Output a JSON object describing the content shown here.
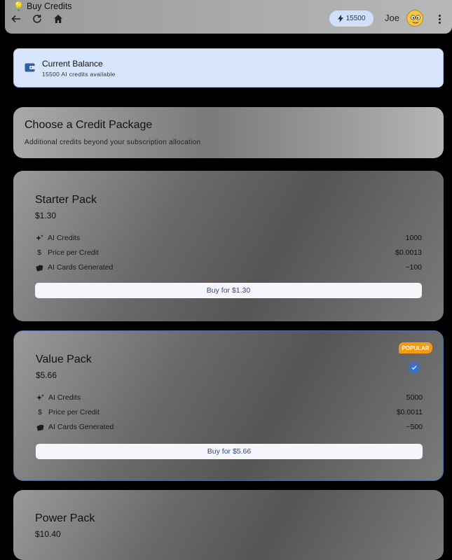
{
  "app": {
    "title": "Buy Credits",
    "credit_chip": "15500",
    "user_name": "Joe"
  },
  "balance": {
    "title": "Current Balance",
    "subtitle": "15500 AI credits available"
  },
  "choose": {
    "title": "Choose a Credit Package",
    "subtitle": "Additional credits beyond your subscription allocation"
  },
  "packages": [
    {
      "name": "Starter Pack",
      "price": "$1.30",
      "rows": [
        {
          "icon": "sparkle-icon",
          "label": "AI Credits",
          "value": "1000"
        },
        {
          "icon": "dollar-icon",
          "label": "Price per Credit",
          "value": "$0.0013"
        },
        {
          "icon": "cards-icon",
          "label": "AI Cards Generated",
          "value": "~100"
        }
      ],
      "buy_label": "Buy for $1.30"
    },
    {
      "name": "Value Pack",
      "price": "$5.66",
      "badge": "POPULAR",
      "selected": true,
      "rows": [
        {
          "icon": "sparkle-icon",
          "label": "AI Credits",
          "value": "5000"
        },
        {
          "icon": "dollar-icon",
          "label": "Price per Credit",
          "value": "$0.0011"
        },
        {
          "icon": "cards-icon",
          "label": "AI Cards Generated",
          "value": "~500"
        }
      ],
      "buy_label": "Buy for $5.66"
    },
    {
      "name": "Power Pack",
      "price": "$10.40"
    }
  ],
  "colors": {
    "accent": "#3f6fc4",
    "badge": "#f59a12",
    "balance_bg": "#d7e6fc",
    "chip_bg": "#cfe0f8"
  }
}
